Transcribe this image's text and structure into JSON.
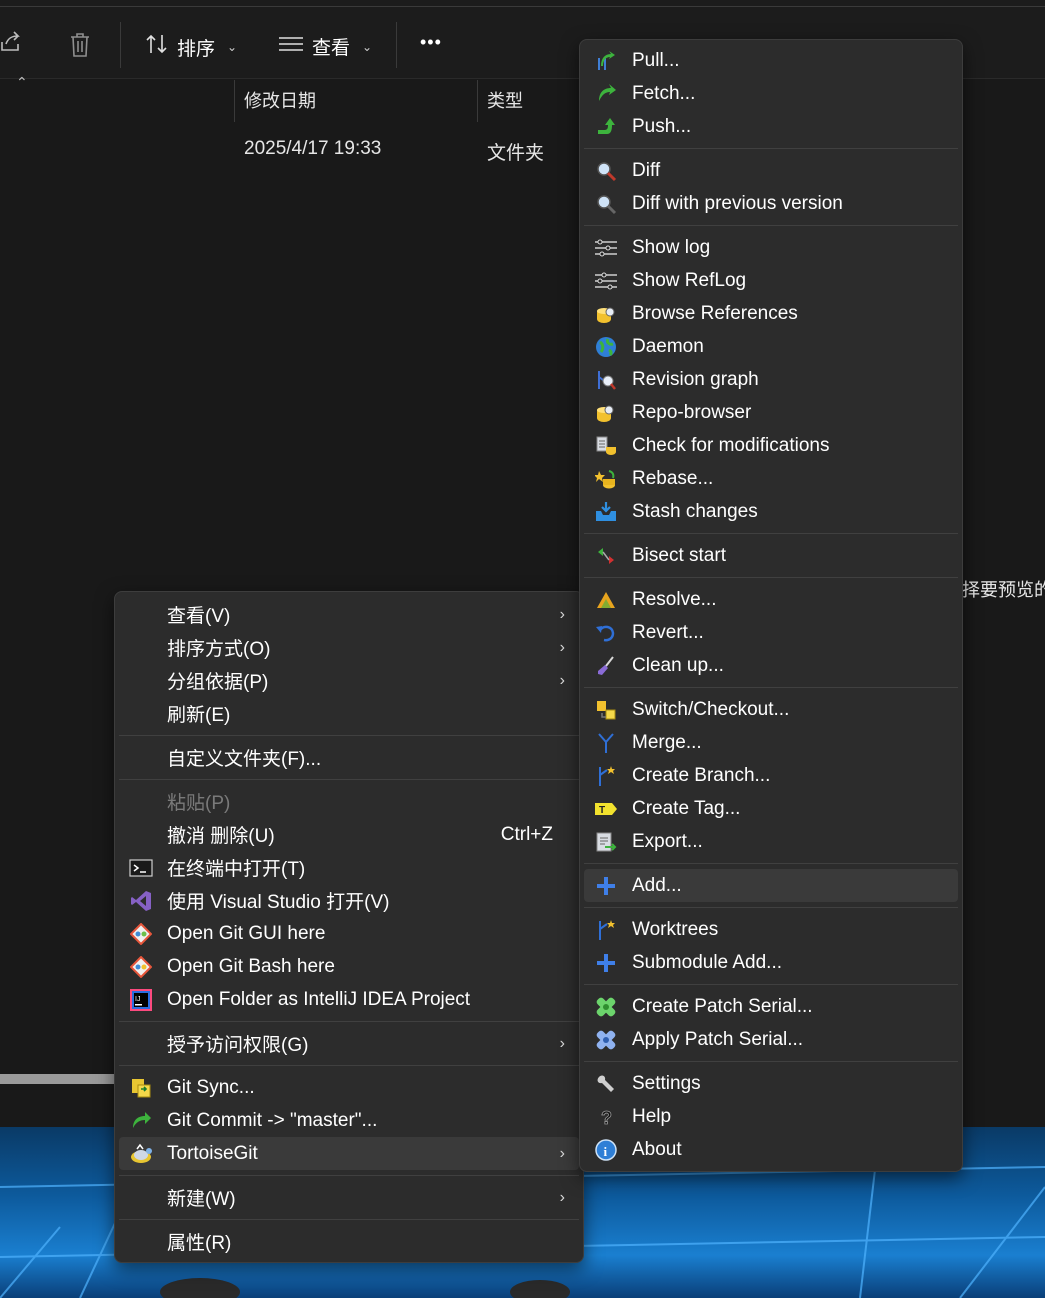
{
  "toolbar": {
    "sort_label": "排序",
    "view_label": "查看",
    "more_label": "•••"
  },
  "columns": {
    "modified": "修改日期",
    "type": "类型"
  },
  "row": {
    "modified": "2025/4/17 19:33",
    "type": "文件夹"
  },
  "preview_hint": "择要预览的",
  "context_menu": {
    "items": [
      {
        "label": "查看(V)",
        "submenu": true
      },
      {
        "label": "排序方式(O)",
        "submenu": true
      },
      {
        "label": "分组依据(P)",
        "submenu": true
      },
      {
        "label": "刷新(E)"
      },
      {
        "label": "自定义文件夹(F)..."
      },
      {
        "label": "粘贴(P)",
        "disabled": true
      },
      {
        "label": "撤消 删除(U)",
        "shortcut": "Ctrl+Z"
      },
      {
        "label": "在终端中打开(T)",
        "icon": "terminal-icon"
      },
      {
        "label": "使用 Visual Studio 打开(V)",
        "icon": "visual-studio-icon"
      },
      {
        "label": "Open Git GUI here",
        "icon": "git-gui-icon"
      },
      {
        "label": "Open Git Bash here",
        "icon": "git-bash-icon"
      },
      {
        "label": "Open Folder as IntelliJ IDEA Project",
        "icon": "intellij-icon"
      },
      {
        "label": "授予访问权限(G)",
        "submenu": true
      },
      {
        "label": "Git Sync...",
        "icon": "git-sync-icon"
      },
      {
        "label": "Git Commit -> \"master\"...",
        "icon": "git-commit-icon"
      },
      {
        "label": "TortoiseGit",
        "icon": "tortoisegit-icon",
        "submenu": true,
        "highlighted": true
      },
      {
        "label": "新建(W)",
        "submenu": true
      },
      {
        "label": "属性(R)"
      }
    ]
  },
  "tortoise_menu": {
    "items": [
      {
        "label": "Pull...",
        "icon": "pull-icon"
      },
      {
        "label": "Fetch...",
        "icon": "fetch-icon"
      },
      {
        "label": "Push...",
        "icon": "push-icon"
      },
      {
        "label": "Diff",
        "icon": "diff-icon"
      },
      {
        "label": "Diff with previous version",
        "icon": "diff-previous-icon"
      },
      {
        "label": "Show log",
        "icon": "show-log-icon"
      },
      {
        "label": "Show RefLog",
        "icon": "show-reflog-icon"
      },
      {
        "label": "Browse References",
        "icon": "browse-references-icon"
      },
      {
        "label": "Daemon",
        "icon": "daemon-globe-icon"
      },
      {
        "label": "Revision graph",
        "icon": "revision-graph-icon"
      },
      {
        "label": "Repo-browser",
        "icon": "repo-browser-icon"
      },
      {
        "label": "Check for modifications",
        "icon": "check-modifications-icon"
      },
      {
        "label": "Rebase...",
        "icon": "rebase-icon"
      },
      {
        "label": "Stash changes",
        "icon": "stash-icon"
      },
      {
        "label": "Bisect start",
        "icon": "bisect-icon"
      },
      {
        "label": "Resolve...",
        "icon": "resolve-icon"
      },
      {
        "label": "Revert...",
        "icon": "revert-icon"
      },
      {
        "label": "Clean up...",
        "icon": "cleanup-icon"
      },
      {
        "label": "Switch/Checkout...",
        "icon": "switch-checkout-icon"
      },
      {
        "label": "Merge...",
        "icon": "merge-icon"
      },
      {
        "label": "Create Branch...",
        "icon": "create-branch-icon"
      },
      {
        "label": "Create Tag...",
        "icon": "create-tag-icon"
      },
      {
        "label": "Export...",
        "icon": "export-icon"
      },
      {
        "label": "Add...",
        "icon": "add-icon",
        "highlighted": true
      },
      {
        "label": "Worktrees",
        "icon": "worktrees-icon"
      },
      {
        "label": "Submodule Add...",
        "icon": "submodule-add-icon"
      },
      {
        "label": "Create Patch Serial...",
        "icon": "create-patch-icon"
      },
      {
        "label": "Apply Patch Serial...",
        "icon": "apply-patch-icon"
      },
      {
        "label": "Settings",
        "icon": "settings-wrench-icon"
      },
      {
        "label": "Help",
        "icon": "help-icon"
      },
      {
        "label": "About",
        "icon": "about-info-icon"
      }
    ]
  },
  "colors": {
    "menu_bg": "#2c2c2c",
    "highlight": "#3a3a3a",
    "explorer_bg": "#191919"
  }
}
